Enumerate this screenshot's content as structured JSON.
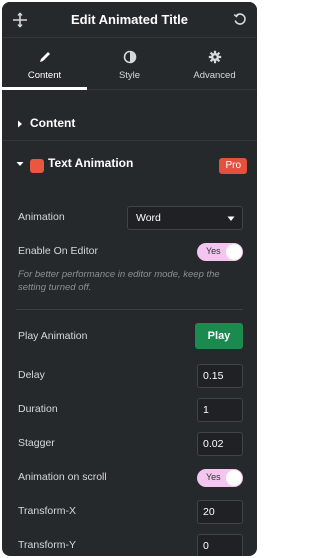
{
  "header": {
    "title": "Edit Animated Title"
  },
  "tabs": [
    {
      "label": "Content",
      "icon": "pencil-icon"
    },
    {
      "label": "Style",
      "icon": "contrast-icon"
    },
    {
      "label": "Advanced",
      "icon": "gear-icon"
    }
  ],
  "sections": {
    "content": {
      "label": "Content"
    },
    "text_animation": {
      "label": "Text Animation",
      "badge": "Pro"
    }
  },
  "fields": {
    "animation": {
      "label": "Animation",
      "value": "Word"
    },
    "enable_on_editor": {
      "label": "Enable On Editor",
      "value": "Yes"
    },
    "editor_hint": "For better performance in editor mode, keep the setting turned off.",
    "play_animation": {
      "label": "Play Animation",
      "button": "Play"
    },
    "delay": {
      "label": "Delay",
      "value": "0.15"
    },
    "duration": {
      "label": "Duration",
      "value": "1"
    },
    "stagger": {
      "label": "Stagger",
      "value": "0.02"
    },
    "animation_on_scroll": {
      "label": "Animation on scroll",
      "value": "Yes"
    },
    "transform_x": {
      "label": "Transform-X",
      "value": "20"
    },
    "transform_y": {
      "label": "Transform-Y",
      "value": "0"
    }
  },
  "colors": {
    "panel_bg": "#26292c",
    "pro_badge": "#e2513b",
    "play_button": "#1b8a4e",
    "toggle_on": "#f3c5ef"
  }
}
